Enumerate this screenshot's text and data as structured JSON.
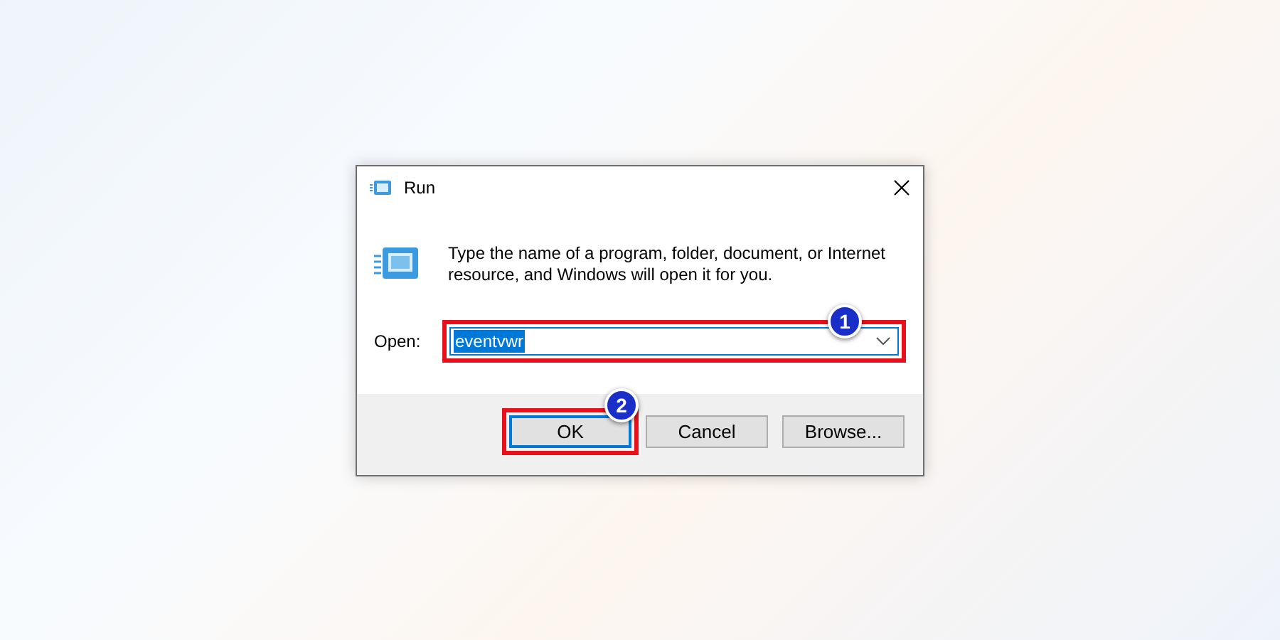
{
  "dialog": {
    "title": "Run",
    "message": "Type the name of a program, folder, document, or Internet resource, and Windows will open it for you.",
    "open_label": "Open:",
    "open_field": {
      "value": "eventvwr",
      "text_selected": true,
      "highlighted": true,
      "callout": "1"
    },
    "buttons": [
      {
        "label": "OK",
        "default": true,
        "highlighted": true,
        "callout": "2"
      },
      {
        "label": "Cancel",
        "default": false,
        "highlighted": false
      },
      {
        "label": "Browse...",
        "default": false,
        "highlighted": false
      }
    ]
  }
}
